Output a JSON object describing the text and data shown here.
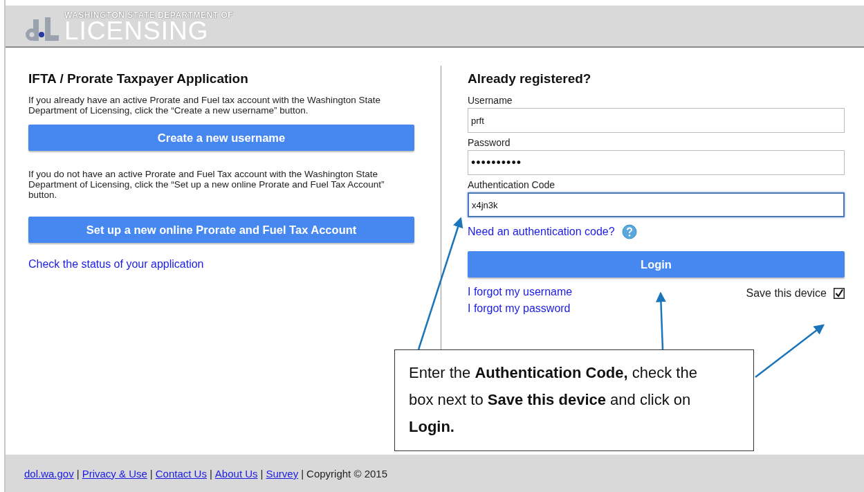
{
  "header": {
    "agency_line": "WASHINGTON STATE DEPARTMENT OF",
    "agency_name": "LICENSING"
  },
  "left": {
    "title": "IFTA / Prorate Taxpayer Application",
    "intro": "If you already have an active Prorate and Fuel tax account with the Washington State Department of Licensing, click the “Create a new username” button.",
    "create_button": "Create a new username",
    "setup_text": "If you do not have an active Prorate and Fuel Tax account with the Washington State Department of Licensing, click the “Set up a new online Prorate and Fuel Tax Account” button.",
    "setup_button": "Set up a new online Prorate and Fuel Tax Account",
    "status_link": "Check the status of your application"
  },
  "login": {
    "title": "Already registered?",
    "fields": [
      {
        "label": "Username",
        "value": "prft",
        "focused": false
      },
      {
        "label": "Password",
        "value": "••••••••••",
        "focused": false
      },
      {
        "label": "Authentication Code",
        "value": "x4jn3k",
        "focused": true
      }
    ],
    "help_link": "Need an authentication code?",
    "login_button": "Login",
    "links": [
      "I forgot my username",
      "I forgot my password"
    ],
    "save_device": {
      "label": "Save this device",
      "checked": true
    }
  },
  "callout": "Enter the **Authentication Code,** check the box next to **Save this device** and click on **Login.**",
  "footer": {
    "items": [
      {
        "kind": "link",
        "text": "dol.wa.gov"
      },
      {
        "kind": "separator",
        "text": "|"
      },
      {
        "kind": "link",
        "text": "Privacy & Use"
      },
      {
        "kind": "separator",
        "text": "|"
      },
      {
        "kind": "link",
        "text": "Contact Us"
      },
      {
        "kind": "separator",
        "text": "|"
      },
      {
        "kind": "link",
        "text": "About Us"
      },
      {
        "kind": "separator",
        "text": "|"
      },
      {
        "kind": "link",
        "text": "Survey"
      },
      {
        "kind": "separator",
        "text": "|"
      }
    ],
    "copyright": "Copyright © 2015"
  }
}
